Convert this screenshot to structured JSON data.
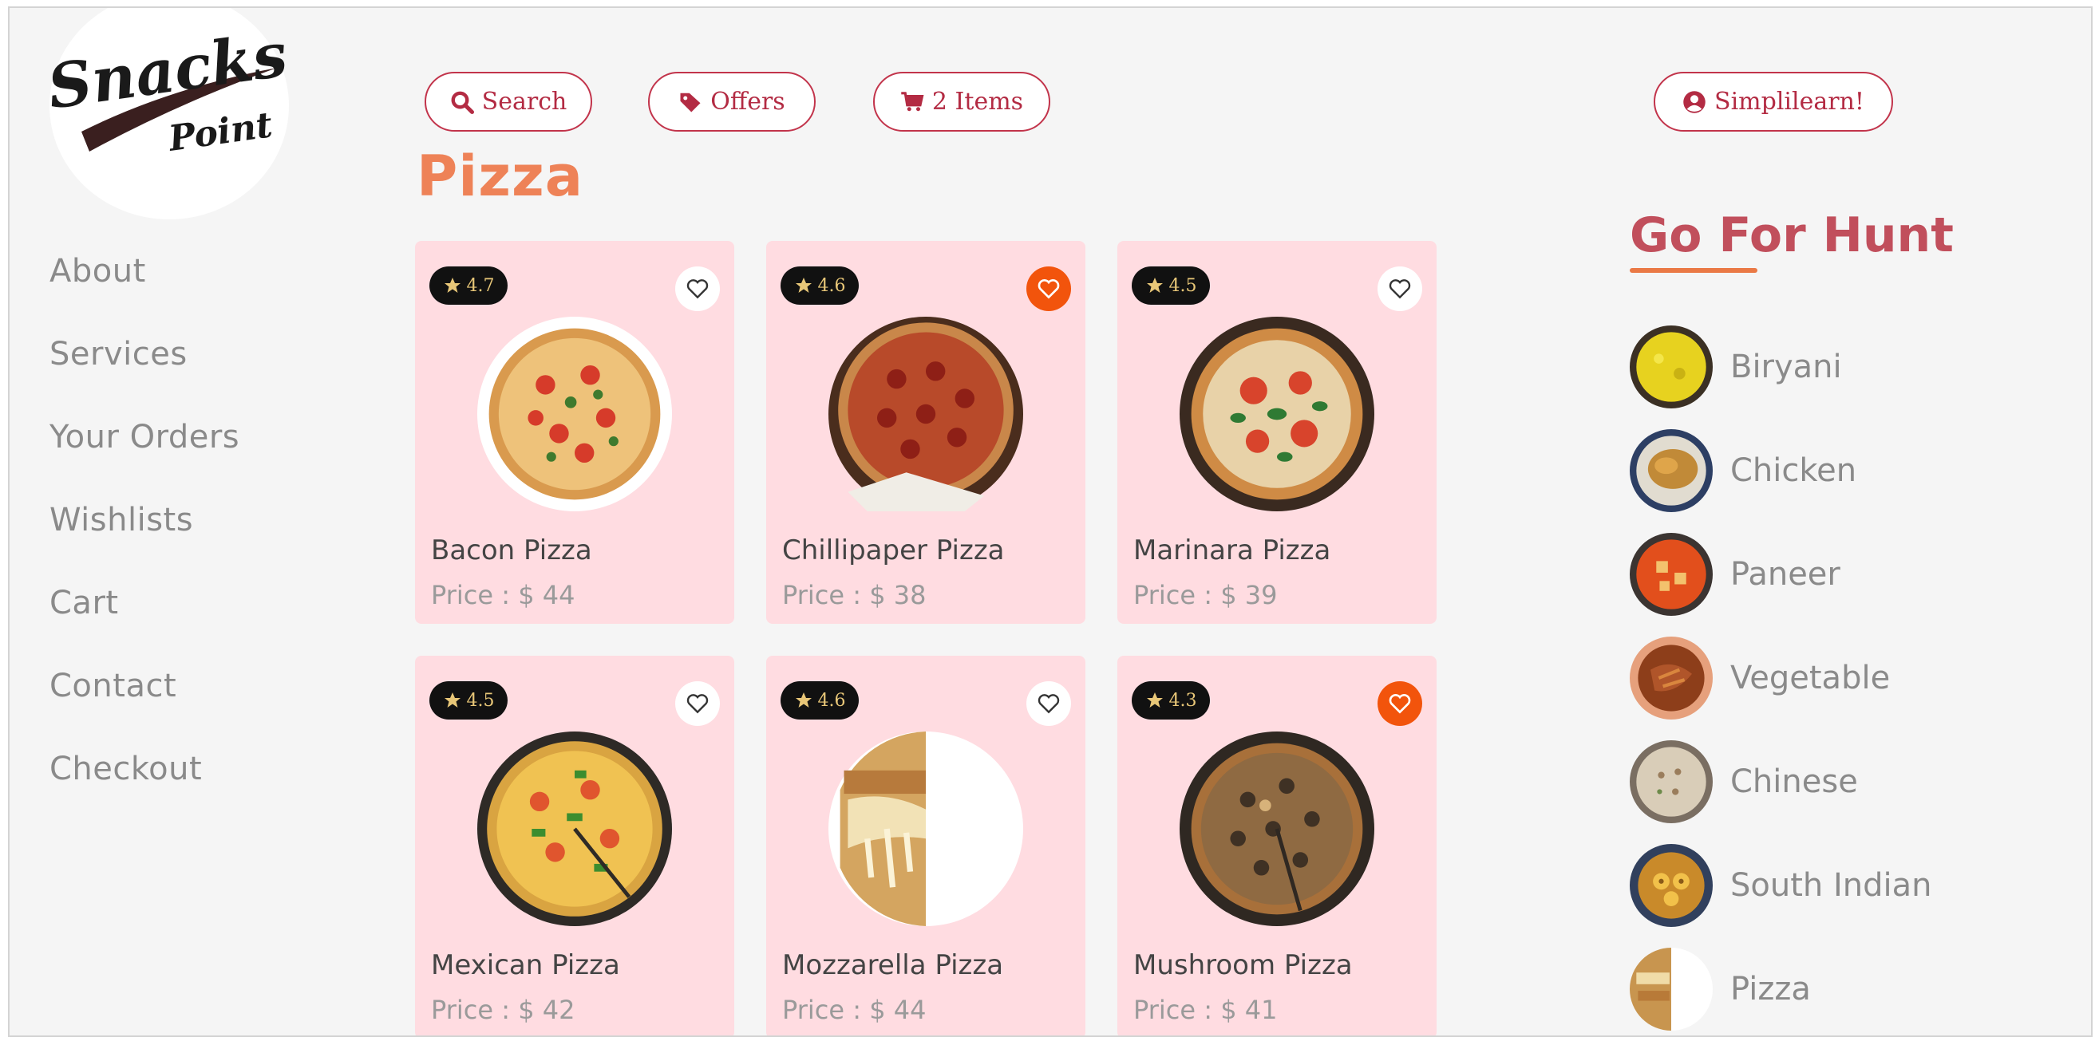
{
  "brand": {
    "logo_line1": "Snacks",
    "logo_line2": "Point"
  },
  "nav": [
    "About",
    "Services",
    "Your Orders",
    "Wishlists",
    "Cart",
    "Contact",
    "Checkout"
  ],
  "toolbar": {
    "search_label": "Search",
    "offers_label": "Offers",
    "cart_label": "2 Items",
    "user_label": "Simplilearn!"
  },
  "page_title": "Pizza",
  "products": [
    {
      "name": "Bacon Pizza",
      "price": "Price : $ 44",
      "rating": "4.7",
      "favorite": false
    },
    {
      "name": "Chillipaper Pizza",
      "price": "Price : $ 38",
      "rating": "4.6",
      "favorite": true
    },
    {
      "name": "Marinara Pizza",
      "price": "Price : $ 39",
      "rating": "4.5",
      "favorite": false
    },
    {
      "name": "Mexican Pizza",
      "price": "Price : $ 42",
      "rating": "4.5",
      "favorite": false
    },
    {
      "name": "Mozzarella Pizza",
      "price": "Price : $ 44",
      "rating": "4.6",
      "favorite": false
    },
    {
      "name": "Mushroom Pizza",
      "price": "Price : $ 41",
      "rating": "4.3",
      "favorite": true
    }
  ],
  "hunt": {
    "title": "Go For Hunt",
    "categories": [
      "Biryani",
      "Chicken",
      "Paneer",
      "Vegetable",
      "Chinese",
      "South Indian",
      "Pizza"
    ]
  },
  "colors": {
    "accent": "#c2344b",
    "title": "#ee8257",
    "card_bg": "#ffdce1",
    "favorite": "#f2540c"
  }
}
